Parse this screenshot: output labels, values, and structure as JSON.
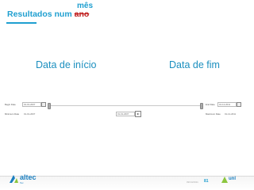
{
  "slide": {
    "title_prefix": "Resultados num ",
    "title_struck": "ano",
    "title_replacement": "mês"
  },
  "labels": {
    "start": "Data de início",
    "end": "Data de fim"
  },
  "date_panel": {
    "begin_date_label": "Begin Date",
    "begin_date_value": "01-01-2007",
    "end_date_label": "End Date",
    "end_date_value": "01-12-2011",
    "minimum_date_label": "Minimum Date",
    "minimum_date_value": "01-01-2007",
    "middle_date_value": "01-01-2007",
    "maximum_date_label": "Maximum Date",
    "maximum_date_value": "01-12-2011"
  },
  "footer": {
    "logo_text": "altec",
    "logo_subtext": "Tec",
    "date": "09/14/2011",
    "page_number": "81",
    "right_logo_text": "unl"
  },
  "colors": {
    "title": "#1f9fd0",
    "strike": "#c02020",
    "label": "#1b8fbf",
    "logo_blue": "#1b7fc0",
    "logo_green": "#8cc63f"
  }
}
